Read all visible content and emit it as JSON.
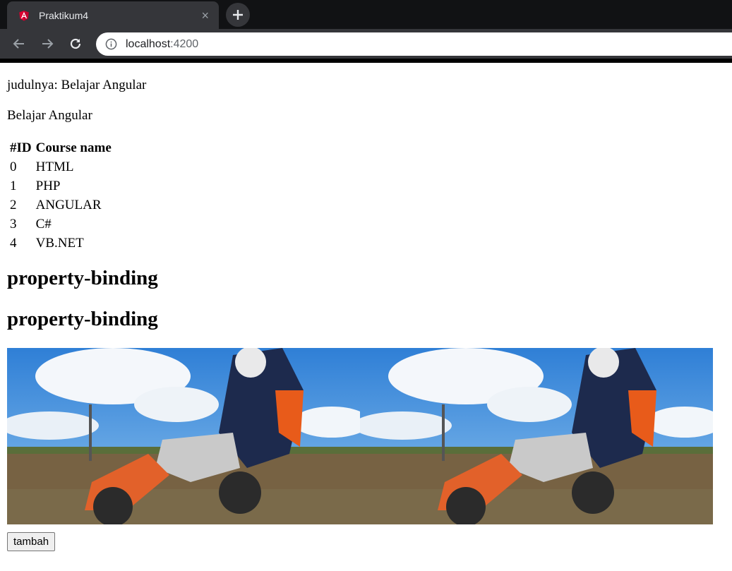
{
  "browser": {
    "tab_title": "Praktikum4",
    "tab_close": "×",
    "url_host": "localhost",
    "url_port": ":4200"
  },
  "page": {
    "line1": "judulnya: Belajar Angular",
    "line2": "Belajar Angular",
    "table": {
      "headers": [
        "#ID",
        "Course name"
      ],
      "rows": [
        [
          "0",
          "HTML"
        ],
        [
          "1",
          "PHP"
        ],
        [
          "2",
          "ANGULAR"
        ],
        [
          "3",
          "C#"
        ],
        [
          "4",
          "VB.NET"
        ]
      ]
    },
    "heading1": "property-binding",
    "heading2": "property-binding",
    "images": [
      {
        "icon": "motocross-photo"
      },
      {
        "icon": "motocross-photo"
      }
    ],
    "button_label": "tambah"
  },
  "colors": {
    "angular_red": "#dd0031",
    "chrome_dark": "#202124",
    "chrome_tab": "#35363a"
  }
}
